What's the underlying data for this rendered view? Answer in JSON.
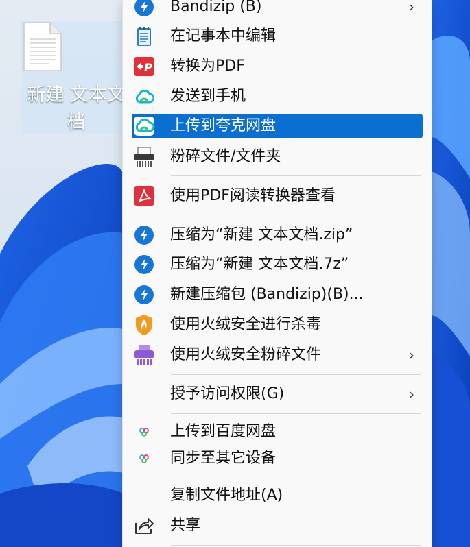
{
  "desktop": {
    "file_label": "新建 文本文档"
  },
  "menu": {
    "items": [
      {
        "label": "Bandizip (B)",
        "icon": "bandizip-icon",
        "submenu": true
      },
      {
        "label": "在记事本中编辑",
        "icon": "notepad-icon"
      },
      {
        "label": "转换为PDF",
        "icon": "pdf-convert-icon"
      },
      {
        "label": "发送到手机",
        "icon": "quark-cloud-icon"
      },
      {
        "label": "上传到夸克网盘",
        "icon": "quark-cloud-icon",
        "highlighted": true
      },
      {
        "label": "粉碎文件/文件夹",
        "icon": "shredder-icon"
      },
      {
        "label": "使用PDF阅读转换器查看",
        "icon": "pdf-reader-icon"
      },
      {
        "label": "压缩为“新建 文本文档.zip”",
        "icon": "bandizip-icon"
      },
      {
        "label": "压缩为“新建 文本文档.7z”",
        "icon": "bandizip-icon"
      },
      {
        "label": "新建压缩包 (Bandizip)(B)...",
        "icon": "bandizip-icon"
      },
      {
        "label": "使用火绒安全进行杀毒",
        "icon": "huorong-shield-icon"
      },
      {
        "label": "使用火绒安全粉碎文件",
        "icon": "huorong-shredder-icon",
        "submenu": true
      },
      {
        "label": "授予访问权限(G)",
        "icon": "",
        "submenu": true
      },
      {
        "label": "上传到百度网盘",
        "icon": "baidu-netdisk-icon"
      },
      {
        "label": "同步至其它设备",
        "icon": "baidu-netdisk-icon"
      },
      {
        "label": "复制文件地址(A)",
        "icon": ""
      },
      {
        "label": "共享",
        "icon": "share-icon"
      }
    ],
    "submenu_arrow": "›"
  },
  "colors": {
    "highlight": "#0a6fd0",
    "menu_bg": "#f9f9f9",
    "bandizip": "#1877d6",
    "pdf_red": "#e0303a"
  }
}
